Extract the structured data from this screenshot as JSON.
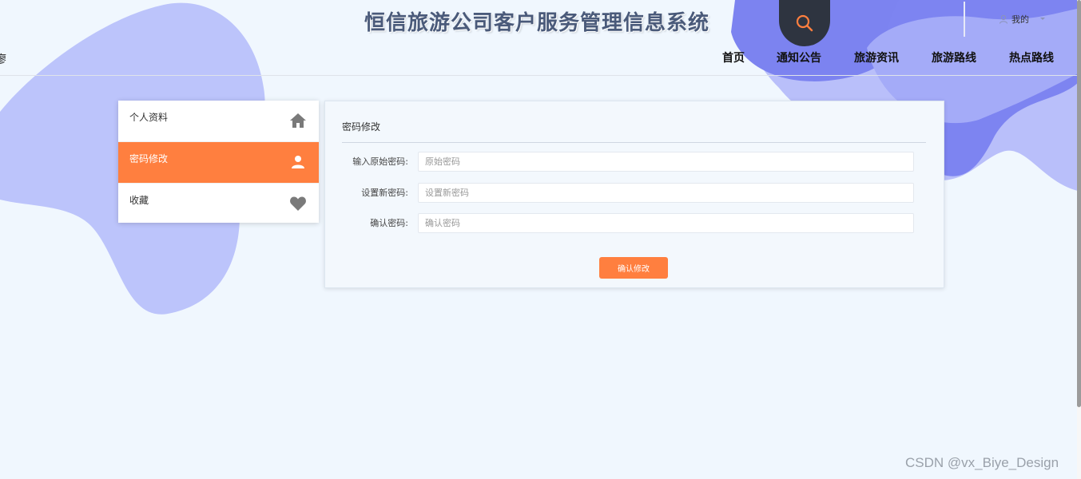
{
  "header": {
    "title": "恒信旅游公司客户服务管理信息系统",
    "left_fragment": "廖",
    "user_label": "我的",
    "search_icon": "search-icon",
    "user_icon": "user-icon",
    "caret_icon": "caret-down-icon"
  },
  "nav": {
    "items": [
      {
        "label": "首页"
      },
      {
        "label": "通知公告"
      },
      {
        "label": "旅游资讯"
      },
      {
        "label": "旅游路线"
      },
      {
        "label": "热点路线"
      }
    ]
  },
  "sidebar": {
    "items": [
      {
        "label": "个人资料",
        "icon": "home-icon",
        "active": false
      },
      {
        "label": "密码修改",
        "icon": "user-icon",
        "active": true
      },
      {
        "label": "收藏",
        "icon": "heart-icon",
        "active": false
      }
    ]
  },
  "form": {
    "title": "密码修改",
    "fields": [
      {
        "label": "输入原始密码:",
        "placeholder": "原始密码",
        "value": ""
      },
      {
        "label": "设置新密码:",
        "placeholder": "设置新密码",
        "value": ""
      },
      {
        "label": "确认密码:",
        "placeholder": "确认密码",
        "value": ""
      }
    ],
    "submit_label": "确认修改"
  },
  "watermark": "CSDN @vx_Biye_Design",
  "colors": {
    "accent": "#ff7f3f",
    "blob_light": "#b8c0fb",
    "blob_dark": "#7c83f0",
    "background": "#f0f7fe",
    "title": "#4a5a7a"
  }
}
